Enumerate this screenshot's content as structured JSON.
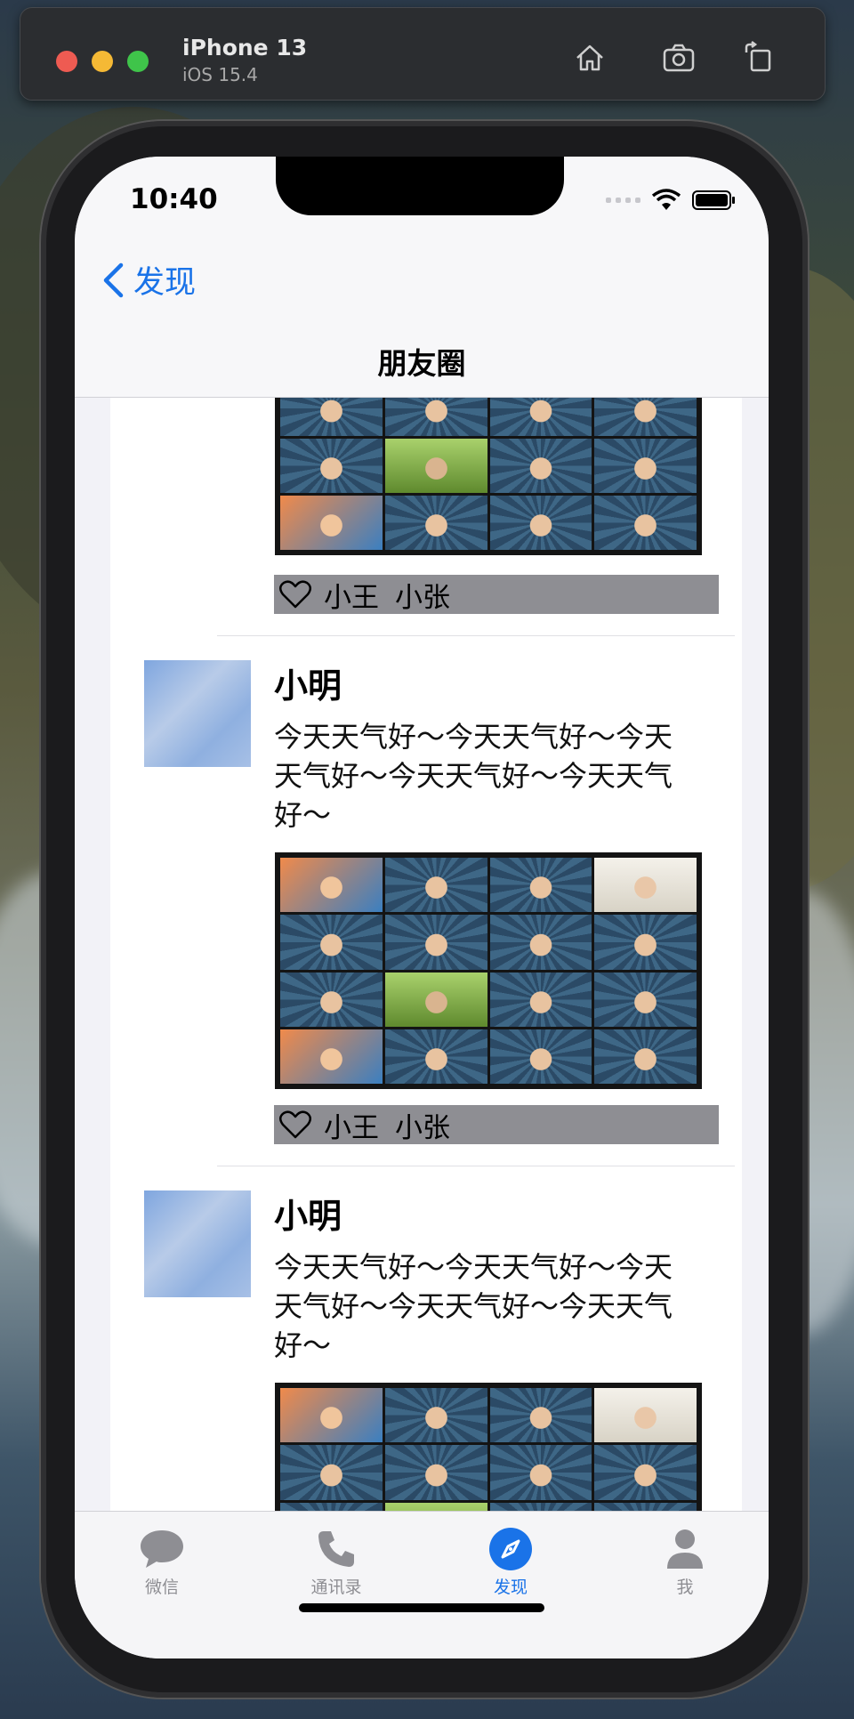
{
  "simulator": {
    "device": "iPhone 13",
    "os": "iOS 15.4",
    "buttons": [
      "home-icon",
      "camera-icon",
      "rotate-icon"
    ]
  },
  "status_bar": {
    "time": "10:40"
  },
  "nav": {
    "back_label": "发现",
    "title": "朋友圈"
  },
  "posts": [
    {
      "name": "",
      "text": "",
      "likes": [
        "小王",
        "小张"
      ]
    },
    {
      "name": "小明",
      "text": "今天天气好～今天天气好～今天天气好～今天天气好～今天天气好～",
      "likes": [
        "小王",
        "小张"
      ]
    },
    {
      "name": "小明",
      "text": "今天天气好～今天天气好～今天天气好～今天天气好～今天天气好～",
      "likes": []
    }
  ],
  "tabs": [
    {
      "label": "微信",
      "icon": "chat-bubble-icon",
      "active": false
    },
    {
      "label": "通讯录",
      "icon": "phone-icon",
      "active": false
    },
    {
      "label": "发现",
      "icon": "compass-icon",
      "active": true
    },
    {
      "label": "我",
      "icon": "person-icon",
      "active": false
    }
  ],
  "colors": {
    "accent": "#1a73e8",
    "like_bar": "#8e8e93"
  }
}
